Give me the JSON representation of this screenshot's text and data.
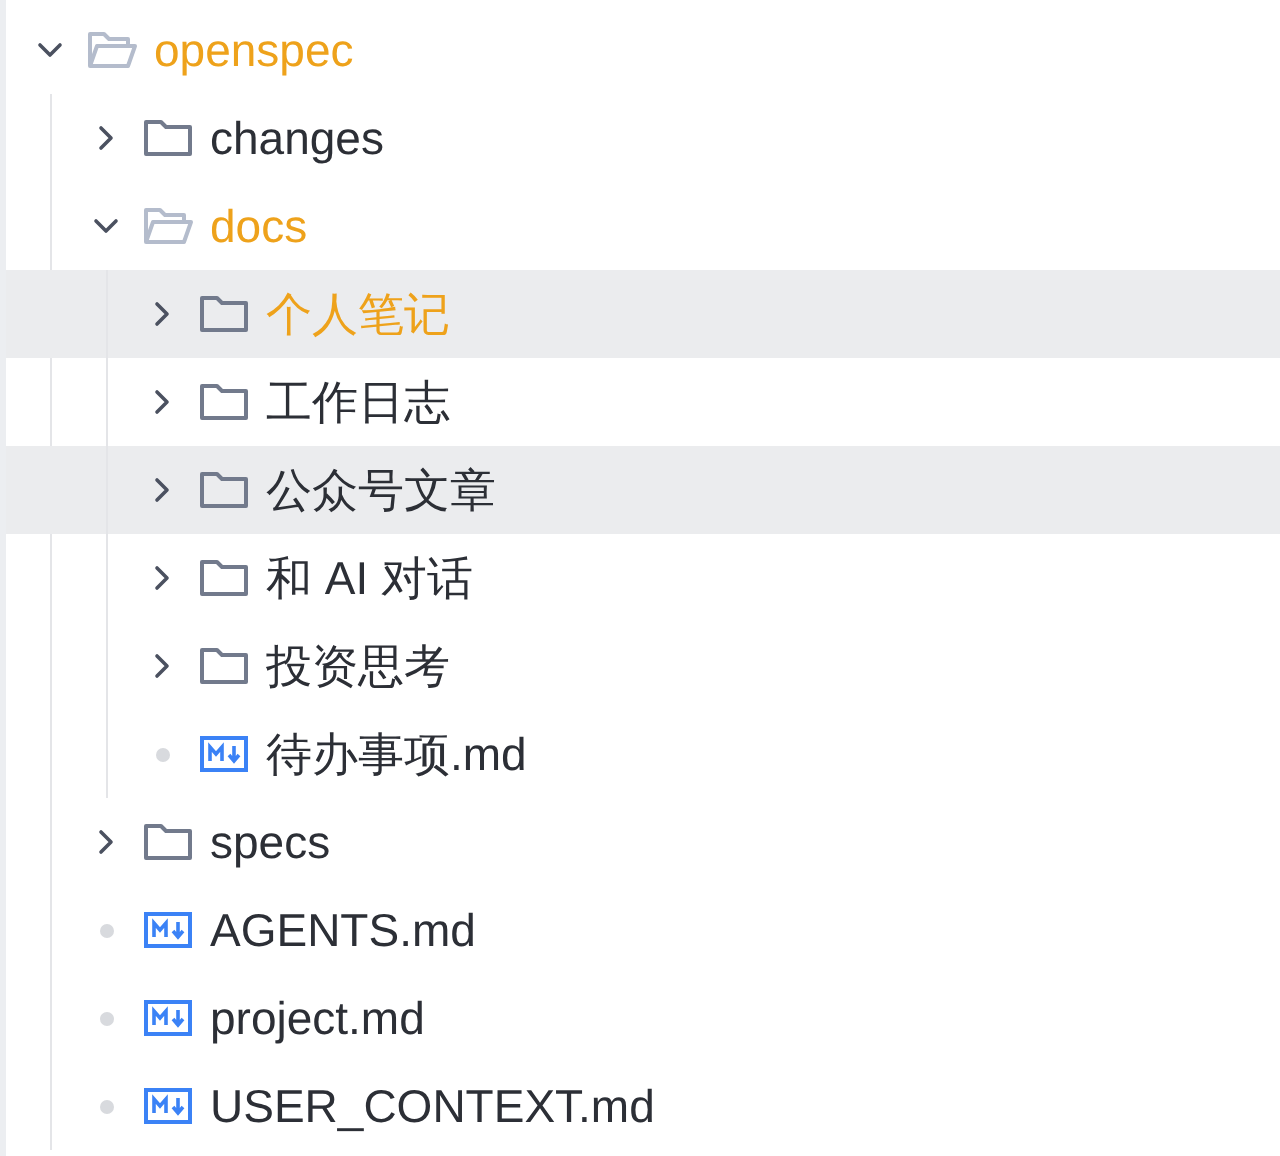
{
  "tree": [
    {
      "kind": "folder",
      "label": "openspec",
      "expanded": true,
      "emphasized": true,
      "highlighted": false,
      "children": [
        {
          "kind": "folder",
          "label": "changes",
          "expanded": false,
          "emphasized": false,
          "highlighted": false
        },
        {
          "kind": "folder",
          "label": "docs",
          "expanded": true,
          "emphasized": true,
          "highlighted": false,
          "children": [
            {
              "kind": "folder",
              "label": "个人笔记",
              "expanded": false,
              "emphasized": true,
              "highlighted": true
            },
            {
              "kind": "folder",
              "label": "工作日志",
              "expanded": false,
              "emphasized": false,
              "highlighted": false
            },
            {
              "kind": "folder",
              "label": "公众号文章",
              "expanded": false,
              "emphasized": false,
              "highlighted": true
            },
            {
              "kind": "folder",
              "label": "和 AI 对话",
              "expanded": false,
              "emphasized": false,
              "highlighted": false
            },
            {
              "kind": "folder",
              "label": "投资思考",
              "expanded": false,
              "emphasized": false,
              "highlighted": false
            },
            {
              "kind": "markdown",
              "label": "待办事项.md",
              "emphasized": false,
              "highlighted": false
            }
          ]
        },
        {
          "kind": "folder",
          "label": "specs",
          "expanded": false,
          "emphasized": false,
          "highlighted": false
        },
        {
          "kind": "markdown",
          "label": "AGENTS.md",
          "emphasized": false,
          "highlighted": false
        },
        {
          "kind": "markdown",
          "label": "project.md",
          "emphasized": false,
          "highlighted": false
        },
        {
          "kind": "markdown",
          "label": "USER_CONTEXT.md",
          "emphasized": false,
          "highlighted": false
        }
      ]
    }
  ]
}
